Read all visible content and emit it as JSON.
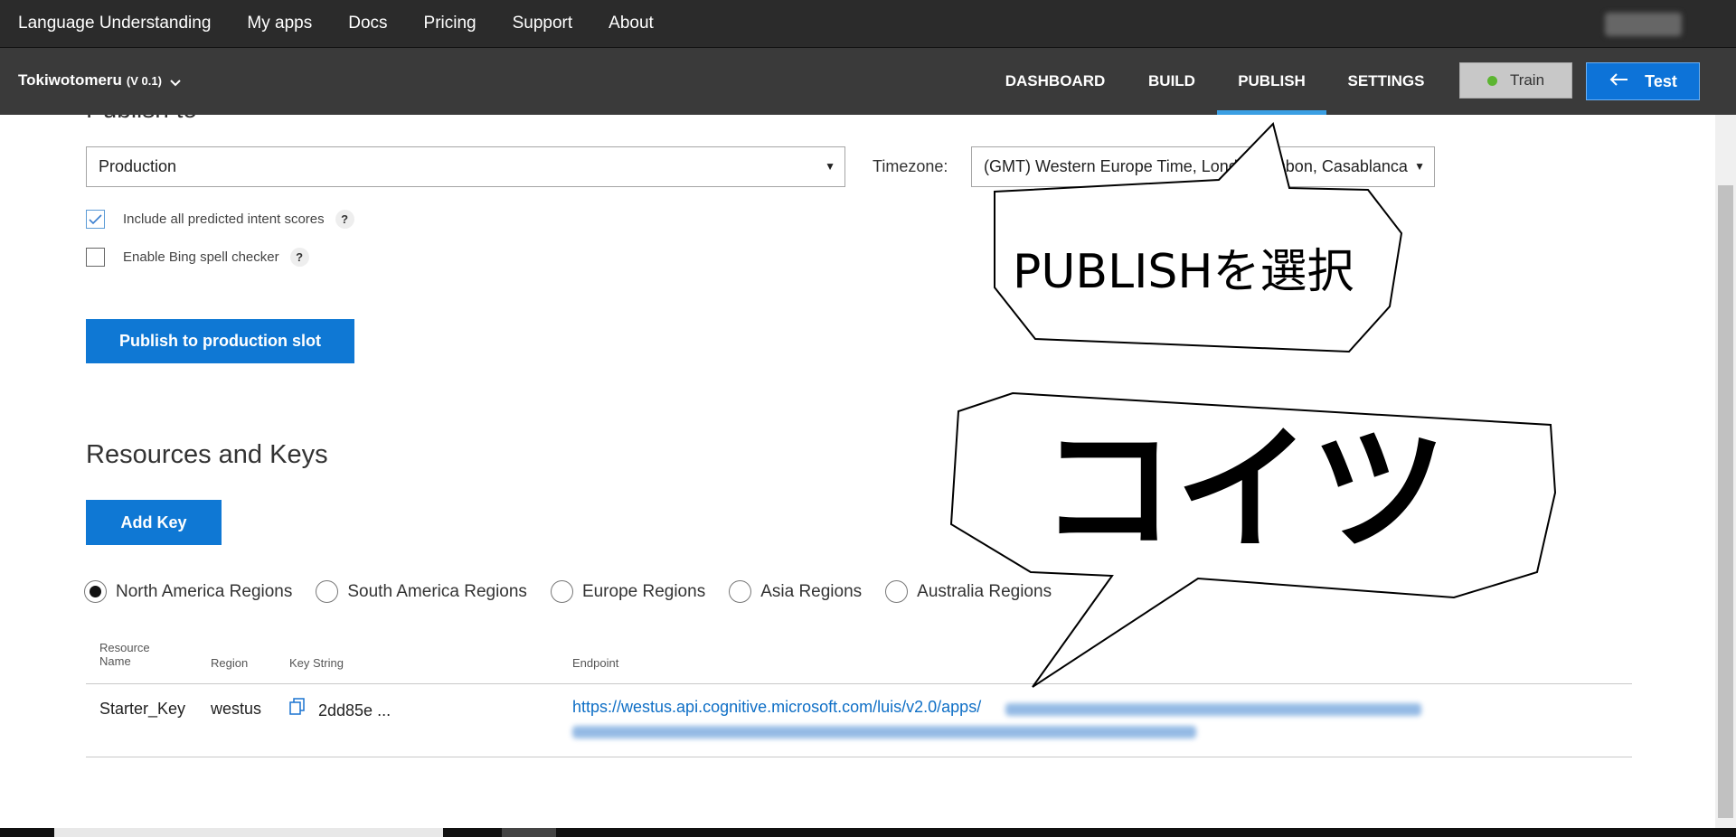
{
  "topnav": {
    "links": [
      "Language Understanding",
      "My apps",
      "Docs",
      "Pricing",
      "Support",
      "About"
    ]
  },
  "appbar": {
    "app_name": "Tokiwotomeru",
    "version": "(V 0.1)",
    "tabs": [
      "DASHBOARD",
      "BUILD",
      "PUBLISH",
      "SETTINGS"
    ],
    "active_tab": "PUBLISH",
    "train_label": "Train",
    "test_label": "Test"
  },
  "publish": {
    "section_title": "Publish to",
    "slot_value": "Production",
    "timezone_label": "Timezone:",
    "timezone_value": "(GMT) Western Europe Time, London, Lisbon, Casablanca",
    "checkbox_intent_label": "Include all predicted intent scores",
    "checkbox_intent_checked": true,
    "checkbox_spell_label": "Enable Bing spell checker",
    "checkbox_spell_checked": false,
    "help_glyph": "?",
    "publish_button": "Publish to production slot"
  },
  "resources": {
    "title": "Resources and Keys",
    "add_key_button": "Add Key",
    "regions": [
      "North America Regions",
      "South America Regions",
      "Europe Regions",
      "Asia Regions",
      "Australia Regions"
    ],
    "selected_region": "North America Regions",
    "table": {
      "headers": {
        "resource_line1": "Resource",
        "resource_line2": "Name",
        "region": "Region",
        "key_string": "Key String",
        "endpoint": "Endpoint"
      },
      "rows": [
        {
          "resource_name": "Starter_Key",
          "region": "westus",
          "key_string": "2dd85e ...",
          "endpoint": "https://westus.api.cognitive.microsoft.com/luis/v2.0/apps/"
        }
      ]
    }
  },
  "callouts": {
    "publish_note": "PUBLISHを選択",
    "endpoint_note": "コイツ"
  },
  "icons": {
    "chevron": "chevron-down-icon",
    "back_arrow": "arrow-left-icon",
    "copy": "copy-icon",
    "check": "checkmark-icon"
  },
  "colors": {
    "primary": "#0f78d4",
    "active_tab_underline": "#3b9fe3",
    "train_dot": "#5cb531",
    "link": "#0f6fc6"
  }
}
